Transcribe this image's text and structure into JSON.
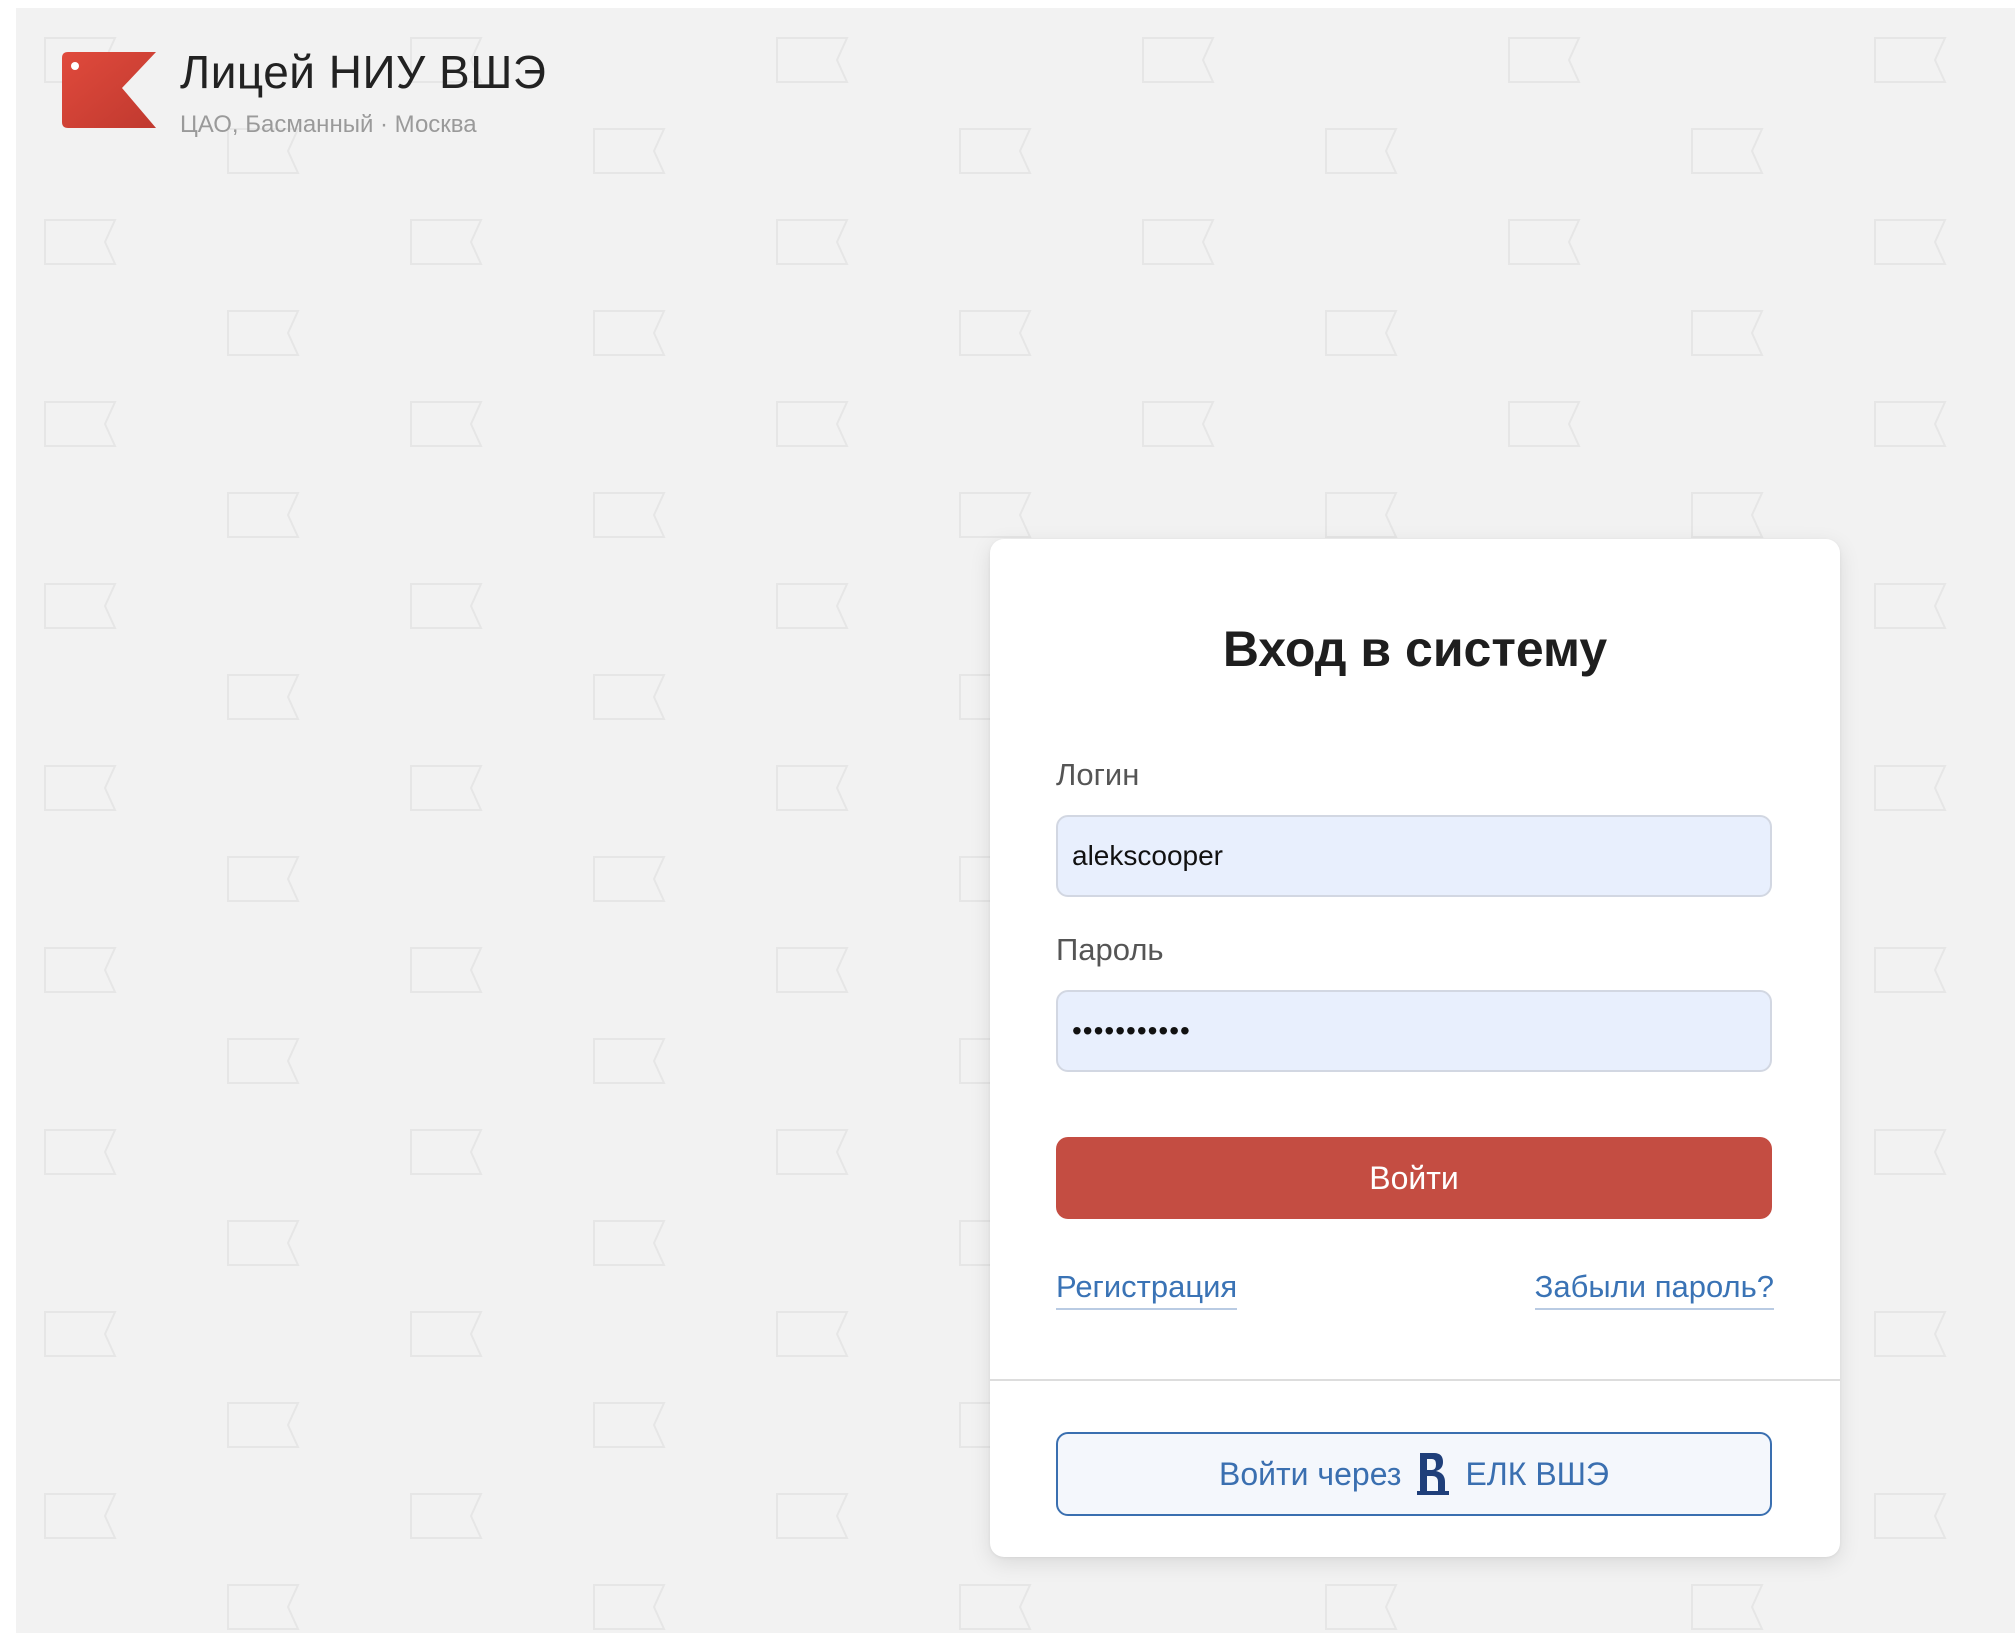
{
  "header": {
    "title": "Лицей НИУ ВШЭ",
    "subtitle": "ЦАО, Басманный · Москва",
    "logo_icon": "lyceum-flag-logo",
    "logo_color": "#d9443a"
  },
  "login_form": {
    "title": "Вход в систему",
    "login_label": "Логин",
    "login_value": "alekscooper",
    "password_label": "Пароль",
    "password_value": "•••••••••••",
    "submit_label": "Войти",
    "register_link": "Регистрация",
    "forgot_link": "Забыли пароль?",
    "sso_prefix": "Войти через",
    "sso_logo_icon": "hse-logo",
    "sso_suffix": "ЕЛК ВШЭ"
  },
  "colors": {
    "accent_red": "#c44d42",
    "link_blue": "#3a73b5",
    "input_bg": "#e8effd",
    "page_bg": "#f2f2f2"
  }
}
